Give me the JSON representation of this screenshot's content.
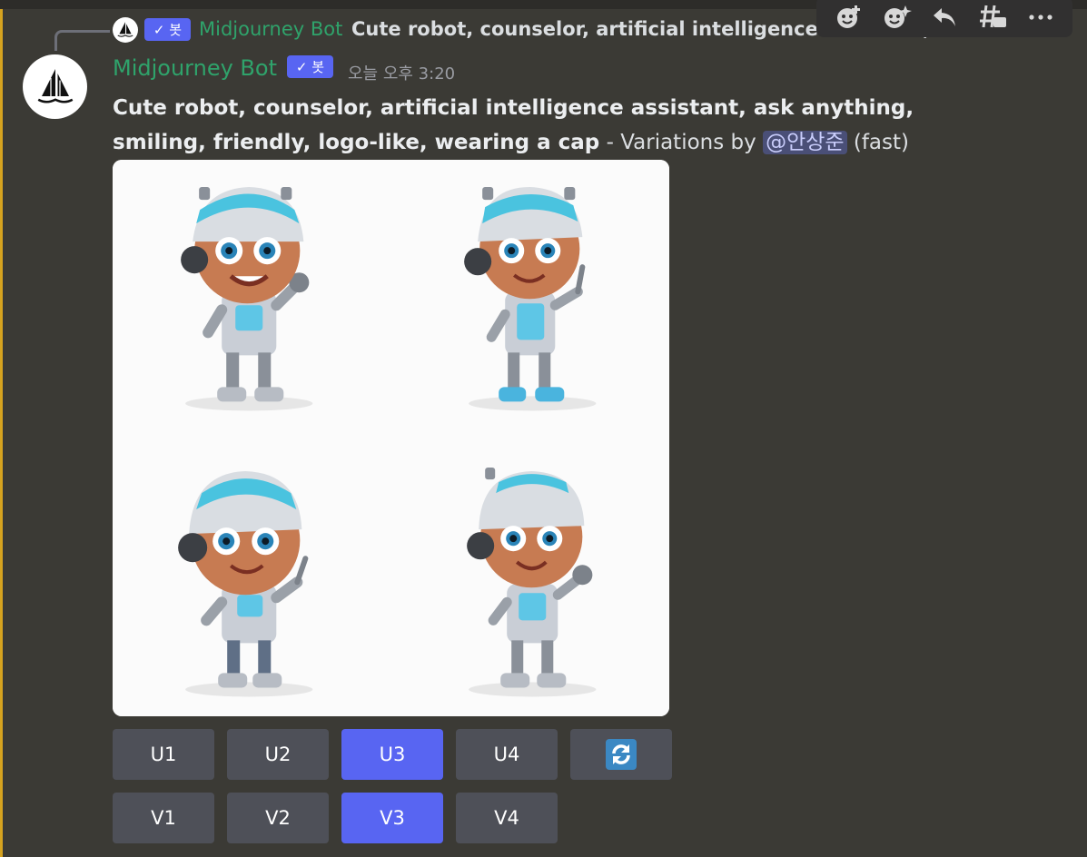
{
  "reply": {
    "bot_label": "봇",
    "author": "Midjourney Bot",
    "preview": "Cute robot, counselor, artificial intelligence assistant, ask anything, smiling, friendly, logo-like, wearing a cap"
  },
  "message": {
    "author": "Midjourney Bot",
    "bot_label": "봇",
    "timestamp": "오늘 오후 3:20",
    "prompt": "Cute robot, counselor, artificial intelligence assistant, ask anything, smiling, friendly, logo-like, wearing a cap",
    "suffix": " - Variations by ",
    "mention": "@안상준",
    "speed": " (fast)"
  },
  "toolbar": {
    "icons": [
      "add-reaction-icon",
      "super-reaction-icon",
      "reply-icon",
      "create-thread-icon",
      "more-options-icon"
    ]
  },
  "buttons": {
    "row1": [
      "U1",
      "U2",
      "U3",
      "U4"
    ],
    "row2": [
      "V1",
      "V2",
      "V3",
      "V4"
    ],
    "active": [
      "U3",
      "V3"
    ],
    "reroll_icon": "reroll-icon"
  },
  "colors": {
    "background": "#3b3a35",
    "accent_bar": "#d5a21f",
    "author": "#2fa36b",
    "blurple": "#5865f2",
    "button_gray": "#4e5058",
    "mention_bg": "#4a4f77"
  }
}
